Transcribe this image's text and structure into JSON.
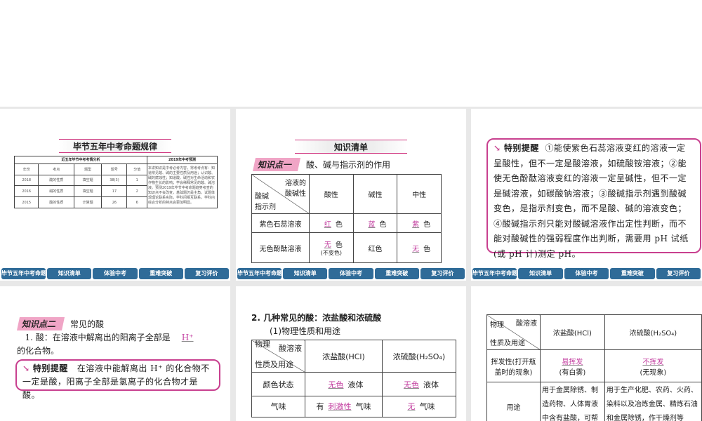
{
  "nav": [
    "毕节五年中考命题规律",
    "知识清单",
    "体验中考",
    "重难突破",
    "复习评价"
  ],
  "s1": {
    "title": "毕节五年中考命题规律",
    "left_header": "近五年毕节中考考情分析",
    "right_header": "2019年中考预测",
    "cols": [
      "年份",
      "考点",
      "题型",
      "题号",
      "分值"
    ],
    "rows": [
      [
        "2018",
        "酸的性质",
        "填空题",
        "38(3)",
        "1"
      ],
      [
        "2016",
        "碱的性质",
        "填空题",
        "17",
        "2"
      ],
      [
        "2015",
        "酸的性质",
        "计算题",
        "26",
        "6"
      ]
    ],
    "prediction": "本讲知识是中考必考内容，常考考点有：知道常见酸、碱的主要性质及用途；认识酸、碱的腐蚀性；知道酸、碱性对生命活动和农作物生长的影响；学会稀释常见的酸、碱溶液。预测2019年毕节中考命题趋势考查的知识点不会改变，基础题仍是主角。试题体现理论联系实际，学科间相互联系，学科内综合分析的特点会更加明显。"
  },
  "s2": {
    "title": "知识清单",
    "tag": "知识点一",
    "tag_text": "酸、碱与指示剂的作用",
    "diag_top1": "溶液的",
    "diag_top2": "酸碱性",
    "diag_mid": "酸碱",
    "diag_bottom": "指示剂",
    "cols": [
      "酸性",
      "碱性",
      "中性"
    ],
    "r1": {
      "label": "紫色石蕊溶液",
      "a": "红",
      "b": "蓝",
      "c": "紫",
      "suffix": "色"
    },
    "r2": {
      "label": "无色酚酞溶液",
      "a": "无",
      "a_note": "(不变色)",
      "b": "红色",
      "c": "无",
      "suffix": "色"
    }
  },
  "s3": {
    "heading": "特别提醒",
    "text": "①能使紫色石蕊溶液变红的溶液一定呈酸性，但不一定是酸溶液，如硫酸铵溶液；②能使无色酚酞溶液变红的溶液一定呈碱性，但不一定是碱溶液，如碳酸钠溶液；③酸碱指示剂遇到酸碱变色，是指示剂变色，而不是酸、碱的溶液变色；④酸碱指示剂只能对酸碱溶液作出定性判断，而不能对酸碱性的强弱程度作出判断，需要用 pH 试纸(或 pH 计)测定 pH。"
  },
  "s4": {
    "tag": "知识点二",
    "tag_text": "常见的酸",
    "line1": "1. 酸：在溶液中解离出的阳离子全部是",
    "blank": "H⁺",
    "line2": "的化合物。",
    "heading": "特别提醒",
    "tip": "在溶液中能解离出 H⁺ 的化合物不一定是酸，阳离子全部是氢离子的化合物才是酸。"
  },
  "s5": {
    "heading": "2. 几种常见的酸：浓盐酸和浓硫酸",
    "sub": "(1)物理性质和用途",
    "diag_top": "酸溶液",
    "diag_mid": "物理",
    "diag_bottom": "性质及用途",
    "col1": "浓盐酸(HCl)",
    "col2": "浓硫酸(H₂SO₄)",
    "r1": {
      "label": "颜色状态",
      "a": "无色",
      "a_suf": "液体",
      "b": "无色",
      "b_suf": "液体"
    },
    "r2": {
      "label": "气味",
      "a_pre": "有",
      "a": "刺激性",
      "a_suf": "气味",
      "b": "无",
      "b_suf": "气味"
    }
  },
  "s6": {
    "diag_top": "酸溶液",
    "diag_mid": "物理",
    "diag_bottom": "性质及用途",
    "col1": "浓盐酸(HCl)",
    "col2": "浓硫酸(H₂SO₄)",
    "r1": {
      "label": "挥发性(打开瓶盖时的现象)",
      "a": "易挥发",
      "a_note": "(有白雾)",
      "b": "不挥发",
      "b_note": "(无现象)"
    },
    "r2": {
      "label": "用途",
      "a": "用于金属除锈、制造药物、人体胃液中含有盐酸，可帮",
      "b": "用于生产化肥、农药、火药、染料以及冶炼金属、精炼石油和金属除锈，作干燥剂等"
    }
  }
}
